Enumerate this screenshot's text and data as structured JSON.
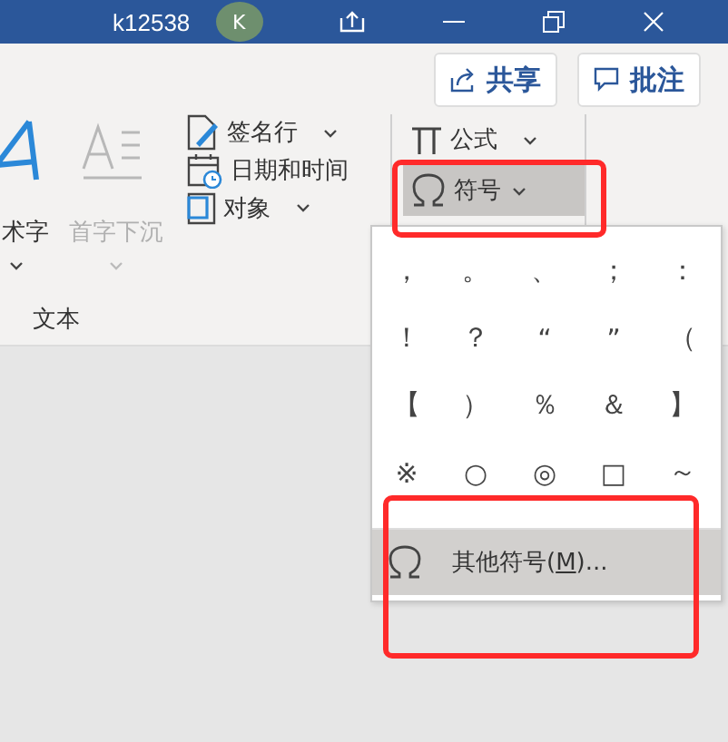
{
  "window": {
    "title": "k12538",
    "avatar": "K"
  },
  "header_buttons": [
    {
      "label": "共享",
      "kind": "share"
    },
    {
      "label": "批注",
      "kind": "comment"
    }
  ],
  "ribbon": {
    "large_buttons": [
      {
        "label": "术字",
        "kind": "wordart",
        "disabled": false
      },
      {
        "label": "首字下沉",
        "kind": "dropcap",
        "disabled": true
      }
    ],
    "small_buttons": [
      {
        "label": "签名行",
        "kind": "signature",
        "has_menu": true
      },
      {
        "label": "日期和时间",
        "kind": "datetime",
        "has_menu": false
      },
      {
        "label": "对象",
        "kind": "object",
        "has_menu": true
      }
    ],
    "symbol_buttons": [
      {
        "label": "公式",
        "kind": "equation",
        "selected": false,
        "highlighted": false
      },
      {
        "label": "符号",
        "kind": "symbol",
        "selected": true,
        "highlighted": true
      }
    ],
    "group_label": "文本"
  },
  "symbol_menu": {
    "symbols": [
      "，",
      "。",
      "、",
      "；",
      "：",
      "！",
      "？",
      "“",
      "”",
      "（",
      "【",
      "）",
      "％",
      "＆",
      "】",
      "※",
      "○",
      "◎",
      "□",
      "～"
    ],
    "more": {
      "before": "其他符号(",
      "mnemonic": "M",
      "after": ")...",
      "selected": true,
      "highlighted": true
    }
  }
}
